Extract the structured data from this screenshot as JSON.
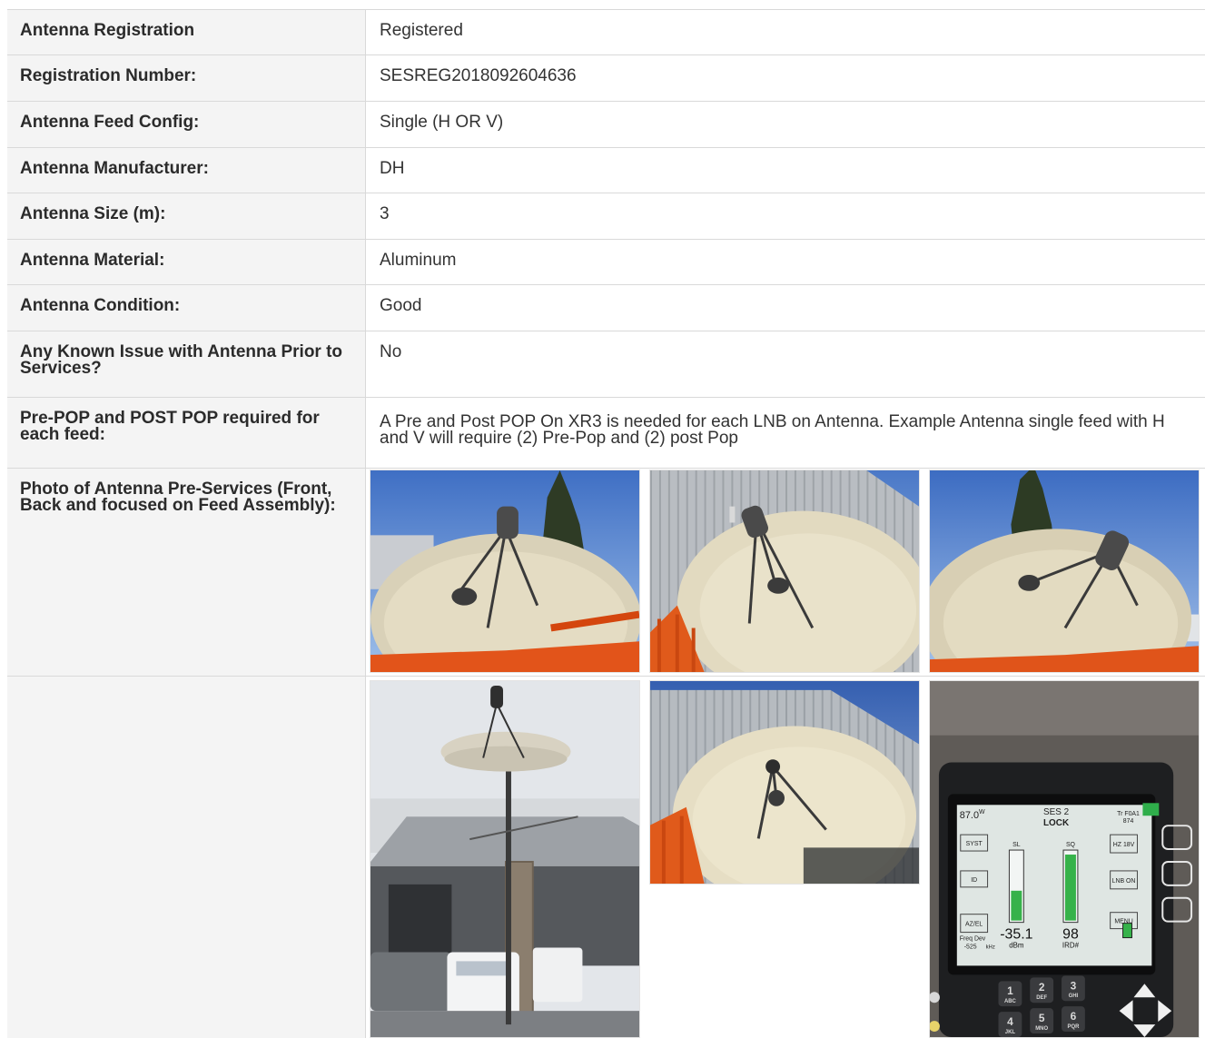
{
  "rows": [
    {
      "label": "Antenna Registration",
      "value": "Registered"
    },
    {
      "label": "Registration Number:",
      "value": "SESREG2018092604636"
    },
    {
      "label": "Antenna Feed Config:",
      "value": "Single (H OR V)"
    },
    {
      "label": "Antenna Manufacturer:",
      "value": "DH"
    },
    {
      "label": "Antenna Size (m):",
      "value": "3"
    },
    {
      "label": "Antenna Material:",
      "value": "Aluminum"
    },
    {
      "label": "Antenna Condition:",
      "value": "Good"
    },
    {
      "label": "Any Known Issue with Antenna Prior to Services?",
      "value": "No"
    },
    {
      "label": "Pre-POP and POST POP required for each feed:",
      "value": "A Pre and Post POP On XR3 is needed for each LNB on Antenna. Example Antenna single feed with H and V will require (2) Pre-Pop and (2) post Pop"
    },
    {
      "label": "Photo of Antenna Pre-Services (Front, Back and focused on Feed Assembly):"
    }
  ],
  "meter": {
    "top_left": "87.0",
    "top_left_sup": "W",
    "satellite": "SES 2",
    "status": "LOCK",
    "top_right_1": "Tr F0A1",
    "top_right_2": "874",
    "btn_left": [
      "SYST",
      "ID",
      "AZ/EL"
    ],
    "btn_right": [
      "HZ 18V",
      "LNB ON",
      "MENU"
    ],
    "bar_labels": [
      "SL",
      "SQ"
    ],
    "reading_1": "-35.1",
    "reading_1_unit": "dBm",
    "reading_2": "98",
    "reading_2_unit": "IRD#",
    "freq_label": "Freq Dev",
    "freq_value": "-525",
    "freq_unit": "kHz",
    "keys": [
      {
        "num": "1",
        "letters": "ABC"
      },
      {
        "num": "2",
        "letters": "DEF"
      },
      {
        "num": "3",
        "letters": "GHI"
      },
      {
        "num": "4",
        "letters": "JKL"
      },
      {
        "num": "5",
        "letters": "MNO"
      },
      {
        "num": "6",
        "letters": "PQR"
      }
    ]
  }
}
